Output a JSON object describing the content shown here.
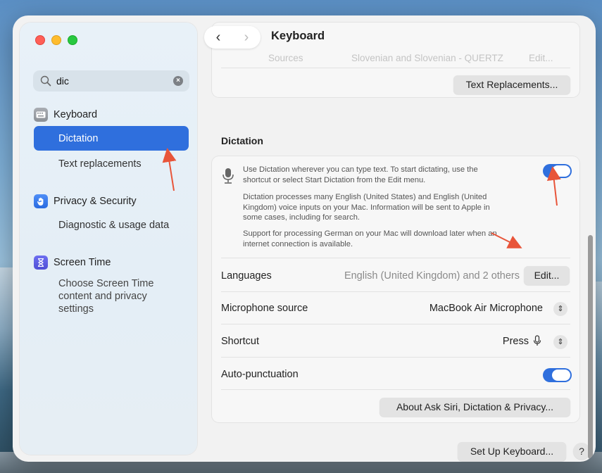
{
  "window": {
    "title": "Keyboard"
  },
  "search": {
    "value": "dic",
    "clear_icon": "clear-icon"
  },
  "sidebar": {
    "sections": [
      {
        "label": "Keyboard",
        "icon": "keyboard-icon"
      },
      {
        "label": "Privacy & Security",
        "icon": "hand-icon"
      },
      {
        "label": "Screen Time",
        "icon": "hourglass-icon"
      }
    ],
    "items": {
      "dictation": "Dictation",
      "text_replacements": "Text replacements",
      "diagnostic": "Diagnostic & usage data",
      "screen_time_line1": "Choose Screen Time",
      "screen_time_line2": "content and privacy",
      "screen_time_line3": "settings"
    }
  },
  "content": {
    "faded_sources": "Sources",
    "faded_input": "Slovenian and Slovenian - QUERTZ",
    "faded_edit": "Edit...",
    "text_replacements_btn": "Text Replacements...",
    "dictation_title": "Dictation",
    "dictation_desc1_l1": "Use Dictation wherever you can type text. To start dictating, use the",
    "dictation_desc1_l2": "shortcut or select Start Dictation from the Edit menu.",
    "dictation_desc2_l1": "Dictation processes many English (United States) and English (United",
    "dictation_desc2_l2": "Kingdom) voice inputs on your Mac. Information will be sent to Apple in",
    "dictation_desc2_l3": "some cases, including for search.",
    "dictation_desc3_l1": "Support for processing German on your Mac will download later when an",
    "dictation_desc3_l2": "internet connection is available.",
    "dictation_enabled": true,
    "languages_label": "Languages",
    "languages_value": "English (United Kingdom) and 2 others",
    "languages_edit": "Edit...",
    "mic_label": "Microphone source",
    "mic_value": "MacBook Air Microphone",
    "shortcut_label": "Shortcut",
    "shortcut_value": "Press",
    "autopunct_label": "Auto-punctuation",
    "autopunct_enabled": true,
    "about_btn": "About Ask Siri, Dictation & Privacy...",
    "setup_btn": "Set Up Keyboard...",
    "help_btn": "?"
  },
  "colors": {
    "accent": "#2f6fdd",
    "annotation_arrow": "#e8553a"
  }
}
